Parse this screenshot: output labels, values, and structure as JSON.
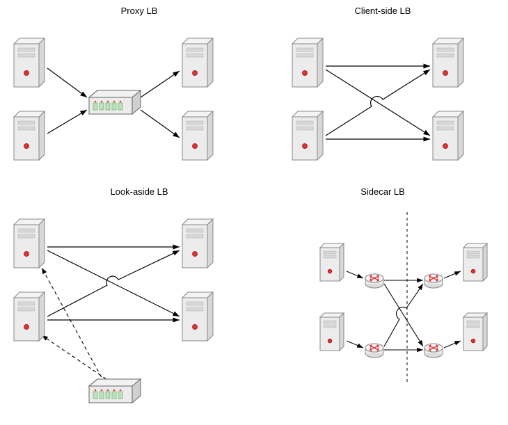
{
  "titles": {
    "proxy": "Proxy LB",
    "client": "Client-side LB",
    "lookaside": "Look-aside LB",
    "sidecar": "Sidecar LB"
  },
  "chart_data": {
    "type": "diagram",
    "title": "Load Balancing Topologies",
    "panels": [
      {
        "name": "Proxy LB",
        "nodes": [
          {
            "id": "c1",
            "type": "server",
            "role": "client"
          },
          {
            "id": "c2",
            "type": "server",
            "role": "client"
          },
          {
            "id": "lb",
            "type": "load-balancer",
            "role": "proxy"
          },
          {
            "id": "s1",
            "type": "server",
            "role": "backend"
          },
          {
            "id": "s2",
            "type": "server",
            "role": "backend"
          }
        ],
        "edges": [
          {
            "from": "c1",
            "to": "lb",
            "style": "solid"
          },
          {
            "from": "c2",
            "to": "lb",
            "style": "solid"
          },
          {
            "from": "lb",
            "to": "s1",
            "style": "solid"
          },
          {
            "from": "lb",
            "to": "s2",
            "style": "solid"
          }
        ]
      },
      {
        "name": "Client-side LB",
        "nodes": [
          {
            "id": "c1",
            "type": "server",
            "role": "client"
          },
          {
            "id": "c2",
            "type": "server",
            "role": "client"
          },
          {
            "id": "s1",
            "type": "server",
            "role": "backend"
          },
          {
            "id": "s2",
            "type": "server",
            "role": "backend"
          }
        ],
        "edges": [
          {
            "from": "c1",
            "to": "s1",
            "style": "solid"
          },
          {
            "from": "c1",
            "to": "s2",
            "style": "solid"
          },
          {
            "from": "c2",
            "to": "s1",
            "style": "solid"
          },
          {
            "from": "c2",
            "to": "s2",
            "style": "solid"
          }
        ]
      },
      {
        "name": "Look-aside LB",
        "nodes": [
          {
            "id": "c1",
            "type": "server",
            "role": "client"
          },
          {
            "id": "c2",
            "type": "server",
            "role": "client"
          },
          {
            "id": "lb",
            "type": "load-balancer",
            "role": "lookaside"
          },
          {
            "id": "s1",
            "type": "server",
            "role": "backend"
          },
          {
            "id": "s2",
            "type": "server",
            "role": "backend"
          }
        ],
        "edges": [
          {
            "from": "c1",
            "to": "s1",
            "style": "solid"
          },
          {
            "from": "c1",
            "to": "s2",
            "style": "solid"
          },
          {
            "from": "c2",
            "to": "s1",
            "style": "solid"
          },
          {
            "from": "c2",
            "to": "s2",
            "style": "solid"
          },
          {
            "from": "lb",
            "to": "c1",
            "style": "dashed"
          },
          {
            "from": "lb",
            "to": "c2",
            "style": "dashed"
          }
        ]
      },
      {
        "name": "Sidecar LB",
        "nodes": [
          {
            "id": "c1",
            "type": "server",
            "role": "client"
          },
          {
            "id": "c2",
            "type": "server",
            "role": "client"
          },
          {
            "id": "sc-c1",
            "type": "router",
            "role": "sidecar-client"
          },
          {
            "id": "sc-c2",
            "type": "router",
            "role": "sidecar-client"
          },
          {
            "id": "sc-s1",
            "type": "router",
            "role": "sidecar-server"
          },
          {
            "id": "sc-s2",
            "type": "router",
            "role": "sidecar-server"
          },
          {
            "id": "s1",
            "type": "server",
            "role": "backend"
          },
          {
            "id": "s2",
            "type": "server",
            "role": "backend"
          }
        ],
        "edges": [
          {
            "from": "c1",
            "to": "sc-c1",
            "style": "solid"
          },
          {
            "from": "c2",
            "to": "sc-c2",
            "style": "solid"
          },
          {
            "from": "sc-c1",
            "to": "sc-s1",
            "style": "solid"
          },
          {
            "from": "sc-c1",
            "to": "sc-s2",
            "style": "solid"
          },
          {
            "from": "sc-c2",
            "to": "sc-s1",
            "style": "solid"
          },
          {
            "from": "sc-c2",
            "to": "sc-s2",
            "style": "solid"
          },
          {
            "from": "sc-s1",
            "to": "s1",
            "style": "solid"
          },
          {
            "from": "sc-s2",
            "to": "s2",
            "style": "solid"
          }
        ],
        "divider": {
          "style": "dashed",
          "orientation": "vertical"
        }
      }
    ]
  }
}
